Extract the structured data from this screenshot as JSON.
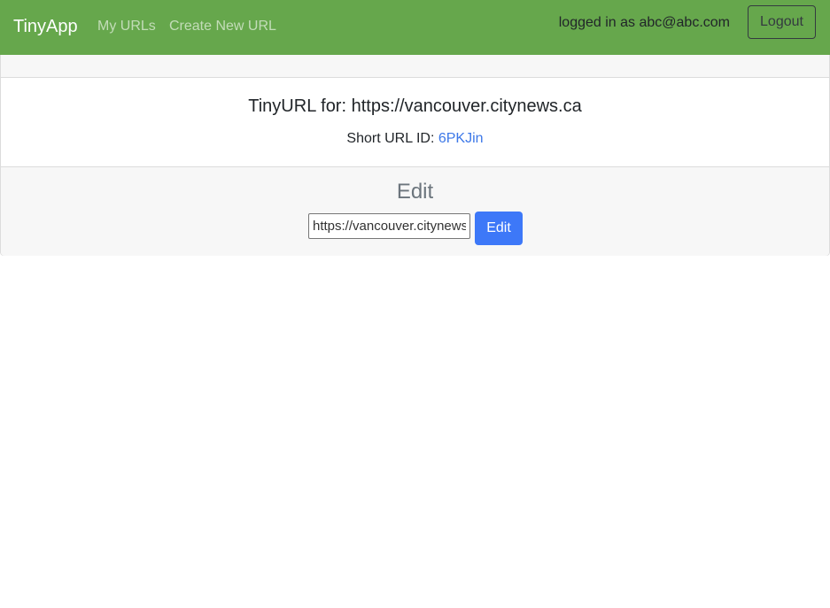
{
  "navbar": {
    "brand": "TinyApp",
    "links": {
      "my_urls": "My URLs",
      "create_new": "Create New URL"
    },
    "login_status": "logged in as abc@abc.com",
    "logout_label": "Logout"
  },
  "card": {
    "title": "TinyURL for: https://vancouver.citynews.ca",
    "short_label": "Short URL ID: ",
    "short_id": "6PKJin"
  },
  "edit": {
    "heading": "Edit",
    "input_value": "https://vancouver.citynews.ca",
    "button_label": "Edit"
  },
  "colors": {
    "navbar_bg": "#66a74c",
    "link_blue": "#3d78e8",
    "button_blue": "#3d78f8"
  }
}
